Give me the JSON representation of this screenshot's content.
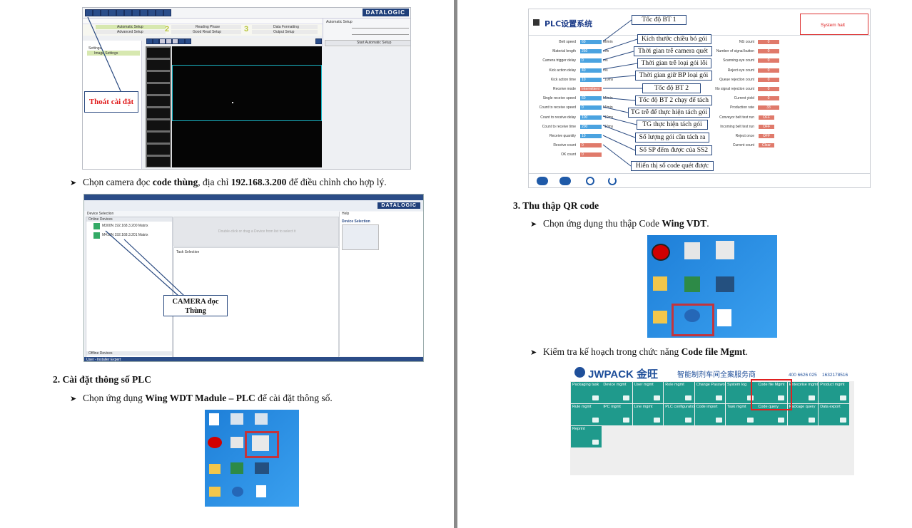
{
  "left_page": {
    "ss1": {
      "logo": "DATALOGIC",
      "step2": "2",
      "step3": "3",
      "automatic_setup": "Automatic Setup",
      "advanced_setup": "Advanced Setup",
      "reading_phase": "Reading Phase",
      "good_read_setup": "Good Read Setup",
      "data_formatting": "Data Formatting",
      "output_setup": "Output Setup",
      "automatic_setup_panel": "Automatic Setup",
      "start_automatic_setup": "Start Automatic Setup",
      "tree_item_1": "Settings",
      "tree_item_2": "Image Settings",
      "callout": "Thoát cài đặt"
    },
    "bullet1": {
      "pre": "Chọn camera đọc ",
      "b1": "code thùng",
      "mid": ", địa chỉ ",
      "b2": "192.168.3.200",
      "post": " để điều chỉnh cho hợp lý."
    },
    "ss2": {
      "logo": "DATALOGIC",
      "device_selection": "Device Selection",
      "online_devices": "Online Devices",
      "offline_devices": "Offline Devices",
      "device1": "M300N 192.168.3.200 Matrix",
      "device2": "M410N 192.168.3.201 Matrix",
      "drop_hint": "Double-click or drag a Device from list to select it",
      "task_selection": "Task Selection",
      "help": "Help",
      "help_title": "Device Selection",
      "status_bar": "User - Installer Expert",
      "callout": "CAMERA đọc Thùng"
    },
    "section2": "2. Cài đặt thông số PLC",
    "bullet2": {
      "pre": "Chọn ứng dụng ",
      "b1": "Wing WDT Madule – PLC",
      "post": " để cài đặt thông số."
    }
  },
  "right_page": {
    "plc": {
      "title": "PLC设置系统",
      "status": "System halt",
      "left_labels": [
        "Belt speed",
        "Material length",
        "Camera trigger delay",
        "Kick action delay",
        "Kick action time",
        "Receive mode",
        "Single receive speed",
        "Count to receive speed",
        "Count to receive delay",
        "Count to receive time",
        "Receive quantity",
        "Receive count",
        "OK count"
      ],
      "left_values": [
        "60",
        "250",
        "0",
        "40",
        "10",
        "Intermittent",
        "60",
        "0",
        "100",
        "200",
        "10",
        "0",
        "0"
      ],
      "left_units": [
        "M/min",
        "mm",
        "ms",
        "ms",
        "*10ms",
        "",
        "M/min",
        "M/min",
        "*10ms",
        "*10ms",
        "",
        "",
        ""
      ],
      "right_labels": [
        "NG count",
        "Number of signal button",
        "Scanning eye count",
        "Reject eye count",
        "Queue rejection count",
        "No signal rejection count",
        "Current yield",
        "Production rate",
        "Conveyor belt test run",
        "Incoming belt test run",
        "Reject once",
        "Current count"
      ],
      "right_values": [
        "0",
        "0",
        "0",
        "0",
        "0",
        "0",
        "0",
        "33",
        "OFF",
        "OFF",
        "OFF",
        "Clear"
      ],
      "callouts": [
        "Tốc độ BT 1",
        "Kích thước chiều bó gói",
        "Thời gian trễ camera  quét",
        "Thời gian trễ loại gói lỗi",
        "Thời gian giữ BP loại gói",
        "Tốc độ BT 2",
        "Tốc độ BT 2 chạy để tách",
        "TG trễ để thực hiện tách gói",
        "TG thực hiện tách gói",
        "Số lượng gói cần tách ra",
        "Số SP đếm được của SS2",
        "Hiển thị số code quét được"
      ]
    },
    "section3": "3.  Thu thập QR code",
    "bullet3": {
      "pre": "Chọn ứng dụng thu thập Code ",
      "b1": "Wing VDT",
      "post": "."
    },
    "bullet4": {
      "pre": "Kiểm tra kế hoạch trong chức năng ",
      "b1": "Code file Mgmt",
      "post": "."
    },
    "jwpack": {
      "logo": "JWPACK 金旺",
      "slogan": "智能制剂车间全案服务商",
      "phone1": "400 6626 025",
      "phone2": "1632178516",
      "row1": [
        "Packaging task",
        "Device mgmt",
        "User mgmt",
        "Role mgmt",
        "Change Password",
        "System log",
        "Code file Mgmt",
        "Enterprise mgmt",
        "Product mgmt"
      ],
      "row2": [
        "Rule mgmt",
        "IPC mgmt",
        "Line mgmt",
        "PLC configuration",
        "Code import",
        "Task mgmt",
        "Code query",
        "Package query",
        "Data export"
      ],
      "row3": [
        "Reprint"
      ]
    }
  },
  "colors": {
    "accent_red": "#d22",
    "teal": "#1f9a8c",
    "desktop_blue": "#2f8fe0"
  }
}
